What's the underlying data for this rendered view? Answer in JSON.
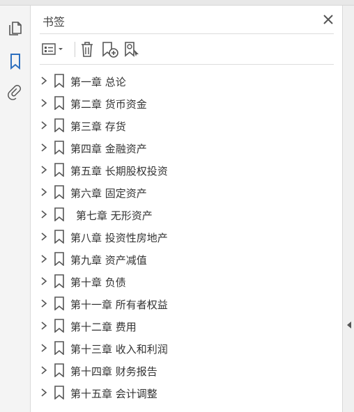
{
  "panel": {
    "title": "书签"
  },
  "toolbar": {
    "options_icon": "list-options-icon",
    "delete_icon": "trash-icon",
    "new_bookmark_icon": "bookmark-add-icon",
    "find_bookmark_icon": "bookmark-find-icon"
  },
  "rail": {
    "pages_icon": "pages-icon",
    "bookmarks_icon": "bookmark-icon",
    "attachments_icon": "paperclip-icon"
  },
  "bookmarks": [
    {
      "label": "第一章  总论"
    },
    {
      "label": "第二章  货币资金"
    },
    {
      "label": "第三章  存货"
    },
    {
      "label": "第四章  金融资产"
    },
    {
      "label": "第五章  长期股权投资"
    },
    {
      "label": "第六章  固定资产"
    },
    {
      "label": "第七章  无形资产"
    },
    {
      "label": "第八章  投资性房地产"
    },
    {
      "label": "第九章  资产减值"
    },
    {
      "label": "第十章  负债"
    },
    {
      "label": "第十一章  所有者权益"
    },
    {
      "label": "第十二章  费用"
    },
    {
      "label": "第十三章  收入和利润"
    },
    {
      "label": "第十四章  财务报告"
    },
    {
      "label": "第十五章  会计调整"
    }
  ],
  "colors": {
    "accent": "#2d6fbf",
    "icon": "#555555",
    "text": "#333333"
  }
}
